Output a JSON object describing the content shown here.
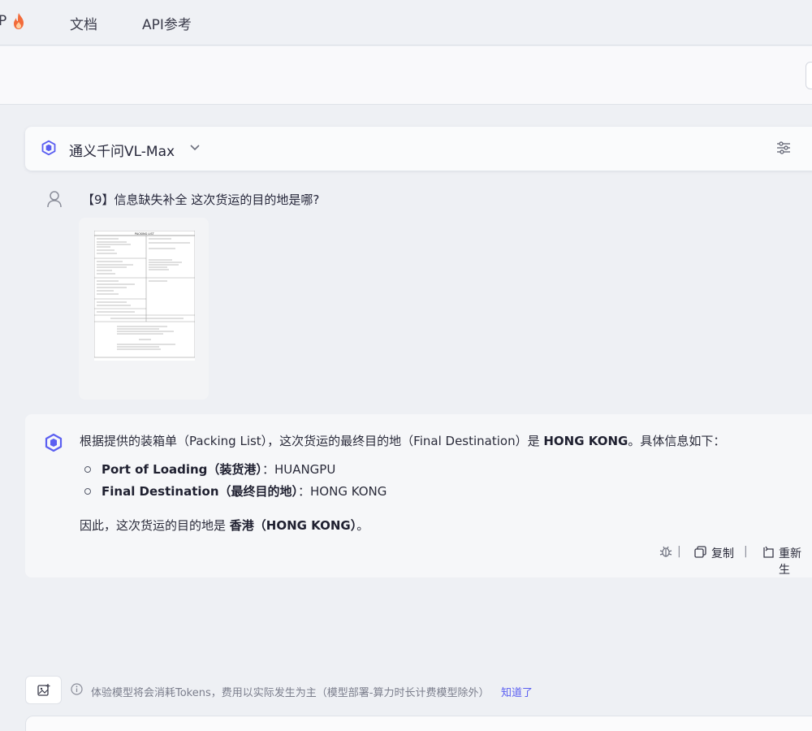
{
  "nav": {
    "partial_label": "P",
    "docs": "文档",
    "api": "API参考"
  },
  "model": {
    "name": "通义千问VL-Max"
  },
  "user_message": {
    "text": "【9】信息缺失补全 这次货运的目的地是哪?"
  },
  "attachment": {
    "doc_title": "PACKING LIST"
  },
  "assistant": {
    "intro_pre": "根据提供的装箱单（Packing List），这次货运的最终目的地（Final Destination）是 ",
    "intro_bold": "HONG KONG",
    "intro_post": "。具体信息如下：",
    "bullets": [
      {
        "label": "Port of Loading（装货港）",
        "value": "：HUANGPU"
      },
      {
        "label": "Final Destination（最终目的地）",
        "value": "：HONG KONG"
      }
    ],
    "conclusion_pre": "因此，这次货运的目的地是 ",
    "conclusion_bold": "香港（HONG KONG）",
    "conclusion_post": "。",
    "actions": {
      "copy": "复制",
      "regenerate": "重新生",
      "separator": "|"
    }
  },
  "footer": {
    "notice": "体验模型将会消耗Tokens，费用以实际发生为主（模型部署-算力时长计费模型除外）",
    "got_it": "知道了"
  },
  "colors": {
    "accent": "#5b5ff1",
    "background": "#eef0f4",
    "fire": "#f26b3a"
  }
}
